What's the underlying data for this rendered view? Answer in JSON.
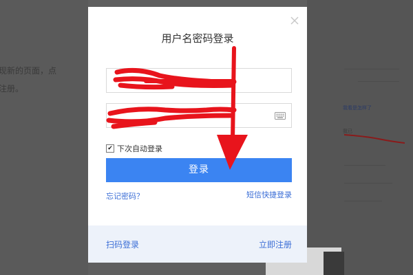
{
  "background": {
    "text_left_1": "现新的页面，点",
    "text_left_2": "注册。",
    "text_right_1": "我看是怎样了",
    "text_right_2": "我已"
  },
  "modal": {
    "title": "用户名密码登录",
    "username": {
      "value": "",
      "placeholder": ""
    },
    "password": {
      "value": "",
      "placeholder": ""
    },
    "remember_checked": true,
    "check_mark": "✔",
    "remember_label": "下次自动登录",
    "login_button": "登录",
    "forgot_password": "忘记密码？",
    "sms_login": "短信快捷登录",
    "scan_login": "扫码登录",
    "register": "立即注册"
  },
  "colors": {
    "primary_button": "#3b84f2",
    "link": "#3b6ed6",
    "annotation_red": "#e8141c"
  },
  "icons": {
    "close": "close-icon",
    "keyboard": "keyboard-icon"
  }
}
